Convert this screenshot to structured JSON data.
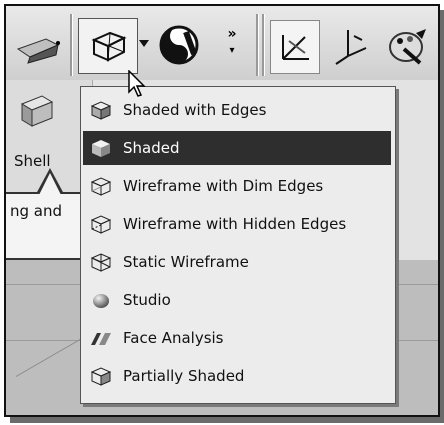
{
  "toolbar": {
    "icons": [
      "shade-cube-icon",
      "display-style-cube-icon",
      "dropdown-arrow-icon",
      "yin-yang-icon",
      "overflow-chevron-icon",
      "view-axes-icon",
      "coordinate-icon",
      "appearance-icon"
    ]
  },
  "ribbon": {
    "shell_label": "Shell"
  },
  "tooltip": {
    "text": "ng and"
  },
  "menu": {
    "items": [
      {
        "label": "Shaded with Edges",
        "icon": "shaded-with-edges-icon"
      },
      {
        "label": "Shaded",
        "icon": "shaded-icon",
        "selected": true
      },
      {
        "label": "Wireframe with Dim Edges",
        "icon": "wireframe-dim-edges-icon"
      },
      {
        "label": "Wireframe with Hidden Edges",
        "icon": "wireframe-hidden-edges-icon"
      },
      {
        "label": "Static Wireframe",
        "icon": "static-wireframe-icon"
      },
      {
        "label": "Studio",
        "icon": "studio-sphere-icon"
      },
      {
        "label": "Face Analysis",
        "icon": "face-analysis-icon"
      },
      {
        "label": "Partially Shaded",
        "icon": "partially-shaded-icon"
      }
    ]
  },
  "colors": {
    "selection_bg": "#2e2e2e",
    "menu_bg": "#ececec"
  }
}
